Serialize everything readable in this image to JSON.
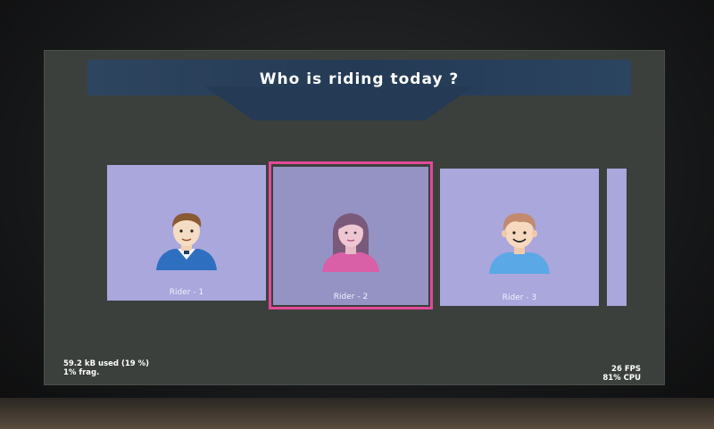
{
  "header": {
    "title": "Who is riding today ?"
  },
  "riders": [
    {
      "label": "Rider - 1",
      "avatar": "man-in-suit-icon"
    },
    {
      "label": "Rider - 2",
      "avatar": "woman-avatar-icon"
    },
    {
      "label": "Rider - 3",
      "avatar": "boy-avatar-icon"
    }
  ],
  "selected_index": 1,
  "status": {
    "memory": "59.2 kB used (19 %)",
    "fragmentation": "1% frag.",
    "fps": "26 FPS",
    "cpu": "81% CPU"
  },
  "colors": {
    "background": "#3b403c",
    "banner": "#243a55",
    "card": "#a9a7dc",
    "selection": "#e24a9a"
  }
}
